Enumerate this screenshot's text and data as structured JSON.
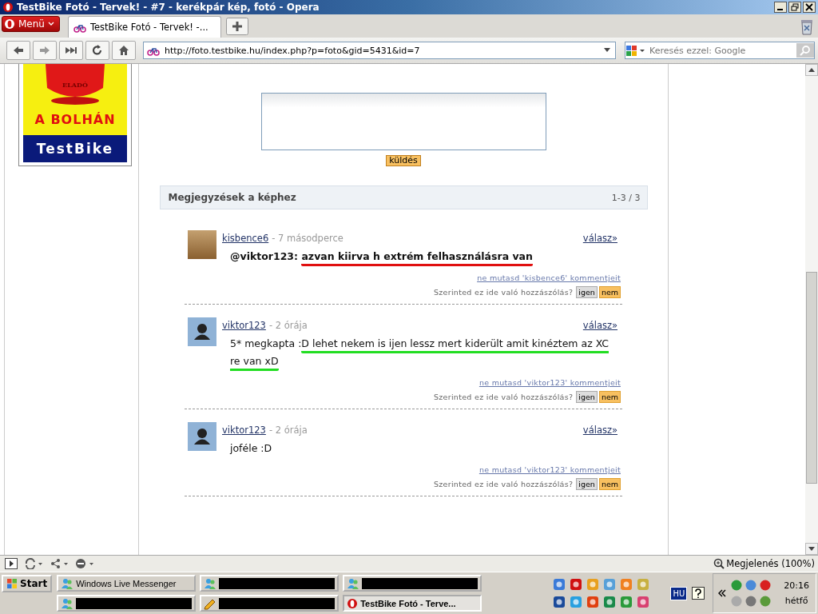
{
  "window": {
    "title": "TestBike Fotó - Tervek! - #7 - kerékpár kép, fotó - Opera"
  },
  "menu_button": "Menü",
  "tabs": [
    {
      "label": "TestBike Fotó - Tervek! -...",
      "selected": true
    }
  ],
  "address_bar": {
    "url": "http://foto.testbike.hu/index.php?p=foto&gid=5431&id=7"
  },
  "search": {
    "placeholder": "Keresés ezzel: Google"
  },
  "banner": {
    "small_text": "ELADÓ",
    "headline": "A BOLHÁN",
    "logo": "TestBike"
  },
  "comment_form": {
    "submit": "küldés"
  },
  "comments_header": {
    "title": "Megjegyzések a képhez",
    "count": "1-3 / 3"
  },
  "comments": [
    {
      "author": "kisbence6",
      "time": "- 7 másodperce",
      "kind": "photo",
      "bold": true,
      "body": [
        {
          "text": "@viktor123: "
        },
        {
          "text": "azvan kiirva h extrém felhasználásra van",
          "color": "#e01010"
        }
      ],
      "reply": "válasz»",
      "hide_link": "ne mutasd 'kisbence6' kommentjeit",
      "question": "Szerinted ez ide való hozzászólás?",
      "yes": "igen",
      "no": "nem"
    },
    {
      "author": "viktor123",
      "time": "- 2 órája",
      "kind": "silhouette",
      "bold": false,
      "body": [
        {
          "text": "5* megkapta :"
        },
        {
          "text": "D lehet nekem is ijen lessz mert kiderült amit kinéztem az XC re van xD",
          "color": "#22dd22"
        }
      ],
      "reply": "válasz»",
      "hide_link": "ne mutasd 'viktor123' kommentjeit",
      "question": "Szerinted ez ide való hozzászólás?",
      "yes": "igen",
      "no": "nem"
    },
    {
      "author": "viktor123",
      "time": "- 2 órája",
      "kind": "silhouette",
      "bold": false,
      "body": [
        {
          "text": "joféle :D"
        }
      ],
      "reply": "válasz»",
      "hide_link": "ne mutasd 'viktor123' kommentjeit",
      "question": "Szerinted ez ide való hozzászólás?",
      "yes": "igen",
      "no": "nem"
    }
  ],
  "status_bar": {
    "zoom": "Megjelenés (100%)"
  },
  "taskbar": {
    "start": "Start",
    "tasks": [
      {
        "kind": "window",
        "label": "Windows Live Messenger",
        "selected": false
      },
      {
        "kind": "redacted",
        "selected": false
      },
      {
        "kind": "redacted",
        "selected": false
      },
      {
        "kind": "redacted",
        "selected": false
      },
      {
        "kind": "redacted",
        "selected": false
      },
      {
        "kind": "window",
        "label": "TestBike Fotó - Terve...",
        "selected": true
      }
    ],
    "language": "HU",
    "clock": "20:16",
    "day": "hétfő"
  }
}
